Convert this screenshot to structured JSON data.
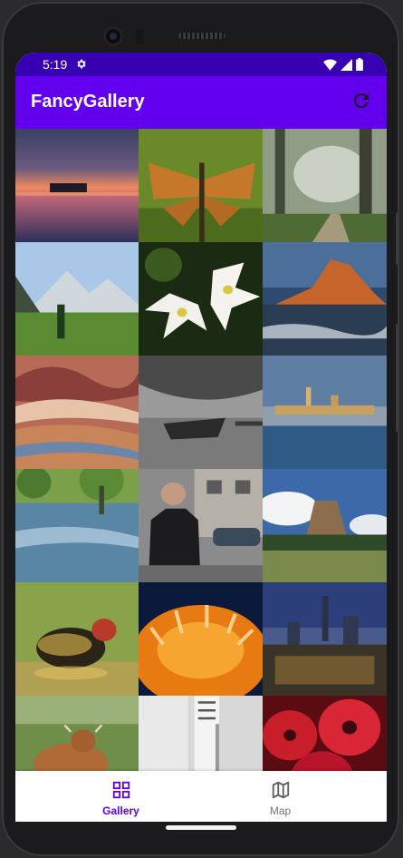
{
  "status_bar": {
    "time": "5:19",
    "icons": [
      "gear-icon",
      "wifi-icon",
      "signal-icon",
      "battery-icon"
    ]
  },
  "app_bar": {
    "title": "FancyGallery",
    "action_icon": "refresh-icon"
  },
  "colors": {
    "status_bar": "#3700b3",
    "app_bar": "#6200ee",
    "nav_selected": "#6200ee",
    "nav_unselected": "#757575"
  },
  "gallery": {
    "columns": 3,
    "photos": [
      {
        "subject": "sunset-lake"
      },
      {
        "subject": "butterfly"
      },
      {
        "subject": "misty-forest-path"
      },
      {
        "subject": "alpine-valley"
      },
      {
        "subject": "white-lilies"
      },
      {
        "subject": "coastal-rock-cliff"
      },
      {
        "subject": "painted-hills"
      },
      {
        "subject": "beached-boat-bw"
      },
      {
        "subject": "city-waterfront"
      },
      {
        "subject": "flooded-trees"
      },
      {
        "subject": "man-leather-jacket-street"
      },
      {
        "subject": "devils-tower"
      },
      {
        "subject": "duckling"
      },
      {
        "subject": "orange-flower-closeup"
      },
      {
        "subject": "city-skyline-dusk"
      },
      {
        "subject": "highland-cow"
      },
      {
        "subject": "white-building-facade"
      },
      {
        "subject": "red-flowers"
      }
    ]
  },
  "bottom_nav": {
    "items": [
      {
        "label": "Gallery",
        "icon": "grid-icon",
        "selected": true
      },
      {
        "label": "Map",
        "icon": "map-icon",
        "selected": false
      }
    ]
  }
}
